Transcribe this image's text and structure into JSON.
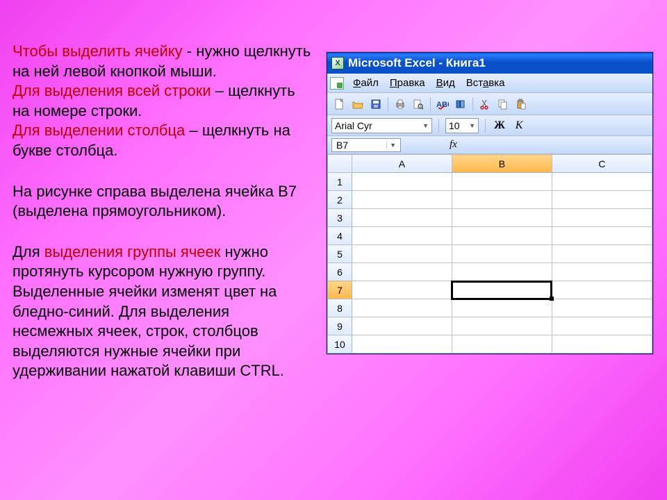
{
  "instruction": {
    "p1_red": "Чтобы выделить ячейку",
    "p1_rest": "  -  нужно щелкнуть на ней левой кнопкой мыши.",
    "p2_red": "Для выделения всей строки",
    "p2_mid": " – щелкнуть на номере строки.",
    "p3_red": "Для выделении столбца",
    "p3_rest": " – щелкнуть на букве столбца.",
    "p4": "На рисунке справа выделена ячейка В7 (выделена прямоугольником).",
    "p5_a": "Для ",
    "p5_red": "выделения группы ячеек",
    "p5_b": " нужно протянуть курсором нужную группу. Выделенные ячейки изменят цвет на бледно-синий. Для выделения несмежных ячеек, строк, столбцов выделяются нужные ячейки при удерживании нажатой клавиши CTRL."
  },
  "excel": {
    "title": "Microsoft Excel - Книга1",
    "menu": {
      "file": "Файл",
      "edit": "Правка",
      "view": "Вид",
      "insert": "Вставка"
    },
    "format": {
      "font": "Arial Cyr",
      "size": "10",
      "bold": "Ж",
      "italic": "К"
    },
    "formula": {
      "namebox": "B7",
      "fx": "fx"
    },
    "columns": [
      "A",
      "B",
      "C"
    ],
    "rows": [
      "1",
      "2",
      "3",
      "4",
      "5",
      "6",
      "7",
      "8",
      "9",
      "10"
    ],
    "selected_col": "B",
    "selected_row": "7"
  }
}
